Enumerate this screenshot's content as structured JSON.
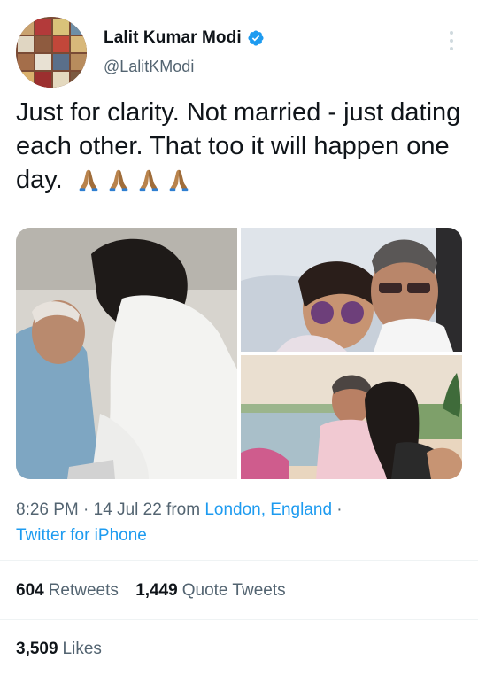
{
  "author": {
    "name": "Lalit Kumar Modi",
    "handle": "@LalitKModi",
    "verified_icon": "verified-badge-icon",
    "avatar": "avatar-photo"
  },
  "tweet": {
    "text": "Just for clarity. Not married - just dating each other. That too it will happen one day.",
    "emoji": [
      "folded-hands",
      "folded-hands",
      "folded-hands",
      "folded-hands"
    ]
  },
  "media": [
    {
      "name": "photo-couple-embrace"
    },
    {
      "name": "photo-selfie-sunglasses"
    },
    {
      "name": "photo-couple-lakeside"
    }
  ],
  "meta": {
    "time": "8:26 PM",
    "dot1": " · ",
    "date": "14 Jul 22",
    "from": " from ",
    "location": "London, England",
    "dot2": " ·",
    "client": "Twitter for iPhone"
  },
  "stats": {
    "retweets_count": "604",
    "retweets_label": "Retweets",
    "quotes_count": "1,449",
    "quotes_label": "Quote Tweets",
    "likes_count": "3,509",
    "likes_label": "Likes"
  },
  "colors": {
    "accent": "#1d9bf0",
    "text": "#0f1419",
    "muted": "#536471",
    "divider": "#eff3f4"
  }
}
